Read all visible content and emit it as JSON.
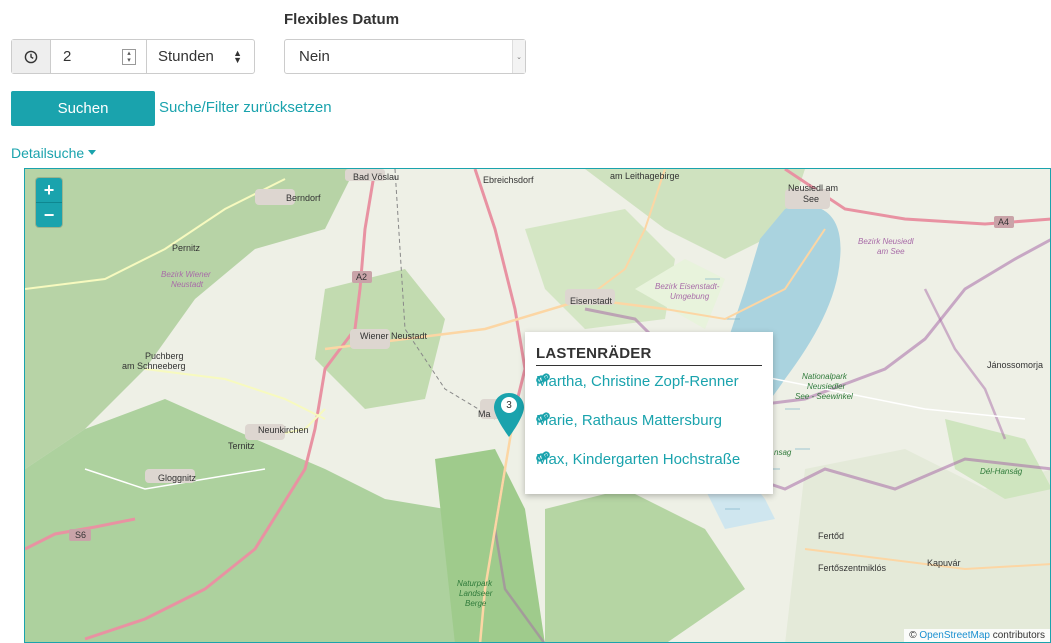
{
  "form": {
    "flexible_date_label": "Flexibles Datum",
    "duration_value": "2",
    "duration_unit": "Stunden",
    "flexible_date_value": "Nein",
    "search_label": "Suchen",
    "reset_label": "Suche/Filter zurücksetzen",
    "detail_label": "Detailsuche"
  },
  "map": {
    "zoom_in": "+",
    "zoom_out": "−",
    "marker_count": "3",
    "popup": {
      "title": "LASTENRÄDER",
      "items": [
        "Martha, Christine Zopf-Renner",
        "Marie, Rathaus Mattersburg",
        "Max, Kindergarten Hochstraße"
      ]
    },
    "attribution": {
      "prefix": "©",
      "link": "OpenStreetMap",
      "suffix": "contributors"
    },
    "labels": {
      "bad_voslau": "Bad Vöslau",
      "ebreichsdorf": "Ebreichsdorf",
      "am_leithagebirge": "am Leithagebirge",
      "neusiedl1": "Neusiedl am",
      "neusiedl2": "See",
      "berndorf": "Berndorf",
      "pernitz": "Pernitz",
      "bezirk_wiener1": "Bezirk Wiener",
      "bezirk_wiener2": "Neustadt",
      "a2": "A2",
      "a4": "A4",
      "s6": "S6",
      "eisenstadt": "Eisenstadt",
      "bezirk_eisen1": "Bezirk Eisenstadt-",
      "bezirk_eisen2": "Umgebung",
      "bezirk_neusiedl1": "Bezirk Neusiedl",
      "bezirk_neusiedl2": "am See",
      "wiener_neustadt": "Wiener Neustadt",
      "puchberg1": "Puchberg",
      "puchberg2": "am Schneeberg",
      "janossomorja": "Jánossomorja",
      "nationalpark1": "Nationalpark",
      "nationalpark2": "Neusiedler",
      "nationalpark3": "See - Seewinkel",
      "ma": "Ma",
      "neunkirchen": "Neunkirchen",
      "ternitz": "Ternitz",
      "gloggnitz": "Gloggnitz",
      "hansag_partial": "nsag",
      "del_hansag": "Dél-Hanság",
      "fertod": "Fertőd",
      "fertoszentmiklos": "Fertőszentmiklós",
      "kapuvar": "Kapuvár",
      "naturpark1": "Naturpark",
      "naturpark2": "Landseer",
      "naturpark3": "Berge"
    }
  },
  "colors": {
    "accent": "#1aa3ad",
    "lake": "#aad3df",
    "forest": "#add19e",
    "land": "#f2efe9",
    "border": "#a86ca8"
  }
}
